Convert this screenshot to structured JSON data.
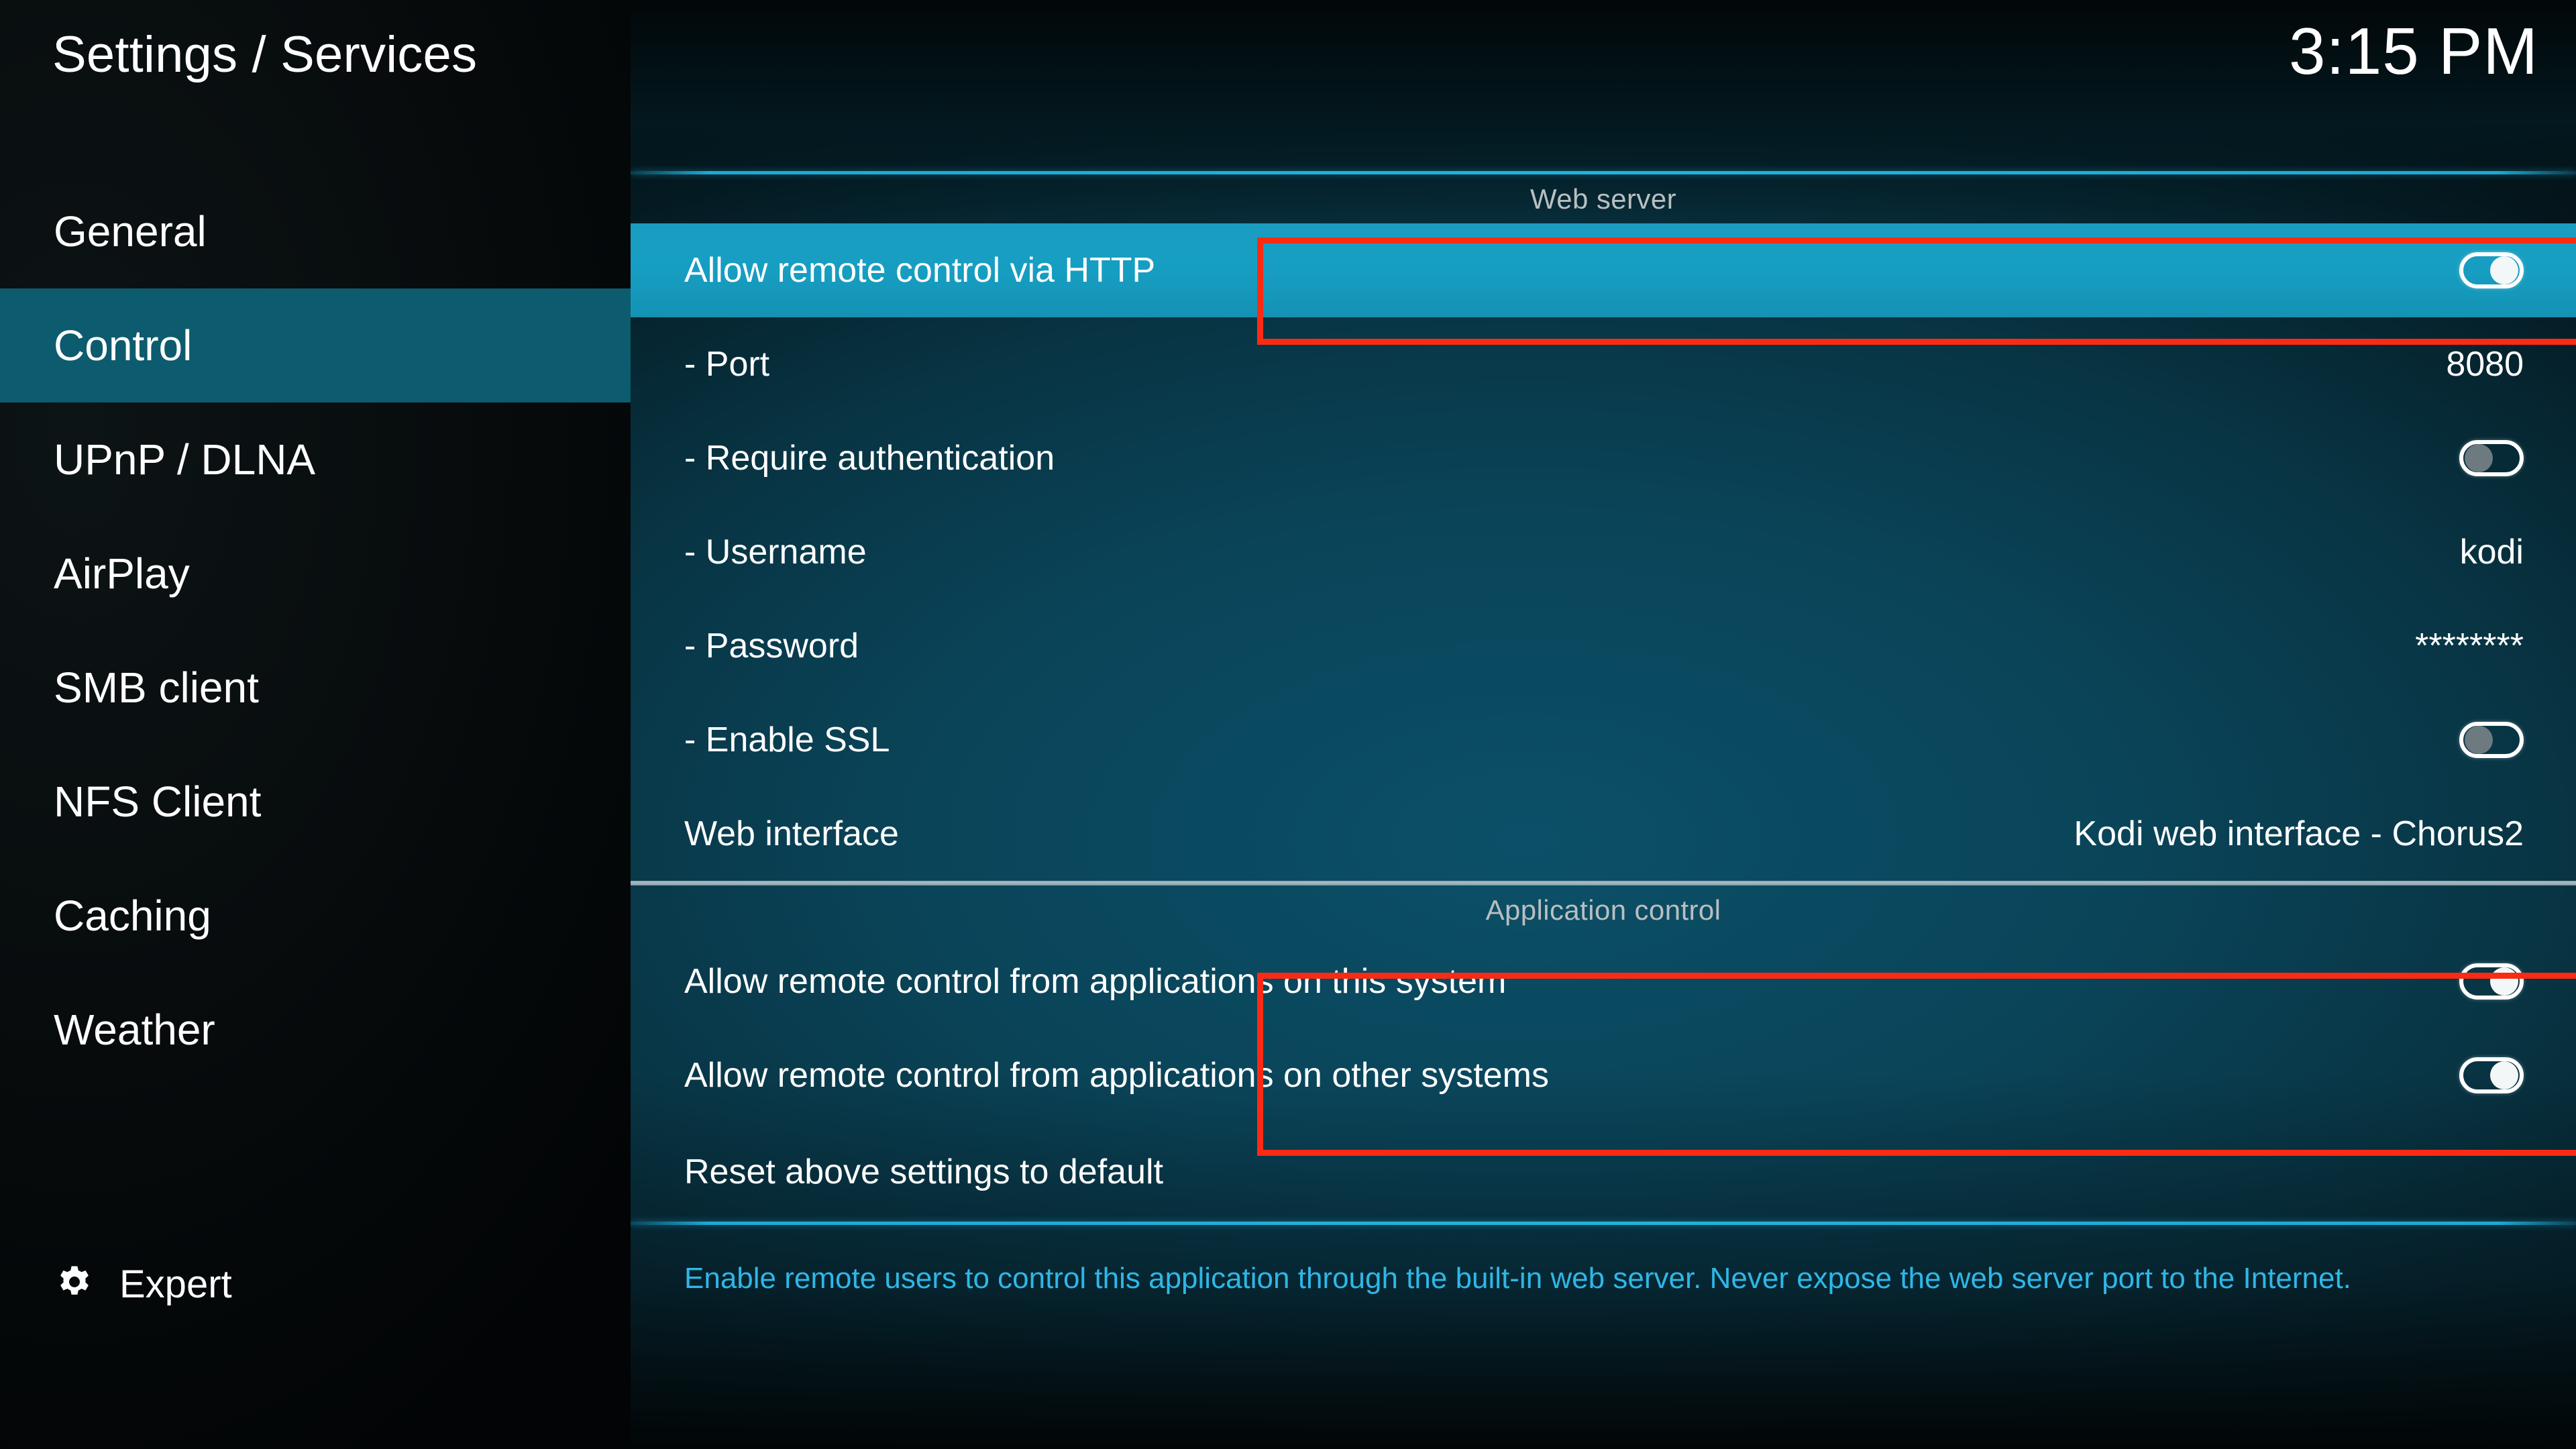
{
  "sidebar": {
    "title": "Settings / Services",
    "items": [
      {
        "label": "General",
        "selected": false
      },
      {
        "label": "Control",
        "selected": true
      },
      {
        "label": "UPnP / DLNA",
        "selected": false
      },
      {
        "label": "AirPlay",
        "selected": false
      },
      {
        "label": "SMB client",
        "selected": false
      },
      {
        "label": "NFS Client",
        "selected": false
      },
      {
        "label": "Caching",
        "selected": false
      },
      {
        "label": "Weather",
        "selected": false
      }
    ],
    "expert": {
      "icon": "gear-icon",
      "label": "Expert"
    }
  },
  "header": {
    "clock": "3:15 PM"
  },
  "sections": [
    {
      "title": "Web server",
      "rows": [
        {
          "label": "Allow remote control via HTTP",
          "control": "toggle",
          "state": "on",
          "focused": true
        },
        {
          "label": "- Port",
          "control": "value",
          "value": "8080"
        },
        {
          "label": "- Require authentication",
          "control": "toggle",
          "state": "off"
        },
        {
          "label": "- Username",
          "control": "value",
          "value": "kodi"
        },
        {
          "label": "- Password",
          "control": "value",
          "value": "********"
        },
        {
          "label": "- Enable SSL",
          "control": "toggle",
          "state": "off"
        },
        {
          "label": "Web interface",
          "control": "value",
          "value": "Kodi web interface - Chorus2"
        }
      ]
    },
    {
      "title": "Application control",
      "rows": [
        {
          "label": "Allow remote control from applications on this system",
          "control": "toggle",
          "state": "on"
        },
        {
          "label": "Allow remote control from applications on other systems",
          "control": "toggle",
          "state": "on"
        }
      ]
    }
  ],
  "reset_row": {
    "label": "Reset above settings to default"
  },
  "description": "Enable remote users to control this application through the built-in web server. Never expose the web server port to the Internet.",
  "colors": {
    "accent": "#1a9dc0",
    "sidebar_selected": "#0d5b6e",
    "separator_cyan": "#1ea9d4",
    "separator_grey": "#a9bcc5",
    "annotation_red": "#fb2b13",
    "description_text": "#2fb7e6",
    "section_head_text": "#b9bfc0"
  }
}
